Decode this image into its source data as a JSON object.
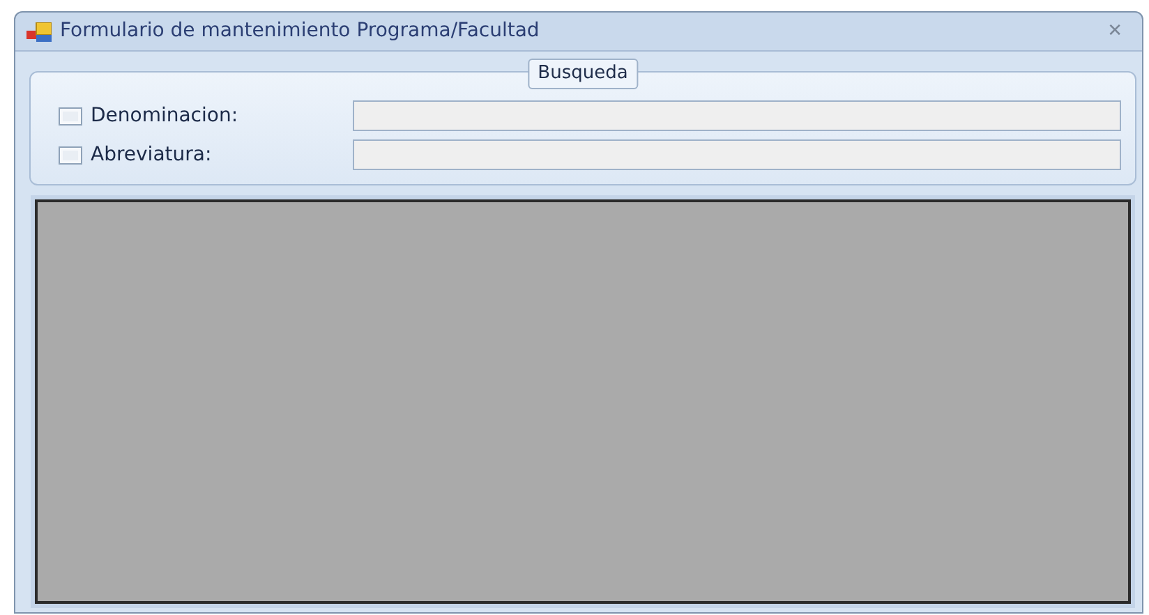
{
  "window": {
    "title": "Formulario de mantenimiento Programa/Facultad",
    "close": "✕"
  },
  "search_group": {
    "title": "Busqueda",
    "filters": [
      {
        "label": "Denominacion:",
        "checked": false
      },
      {
        "label": "Abreviatura:",
        "checked": false
      }
    ]
  },
  "grid": {
    "kind": "empty"
  }
}
